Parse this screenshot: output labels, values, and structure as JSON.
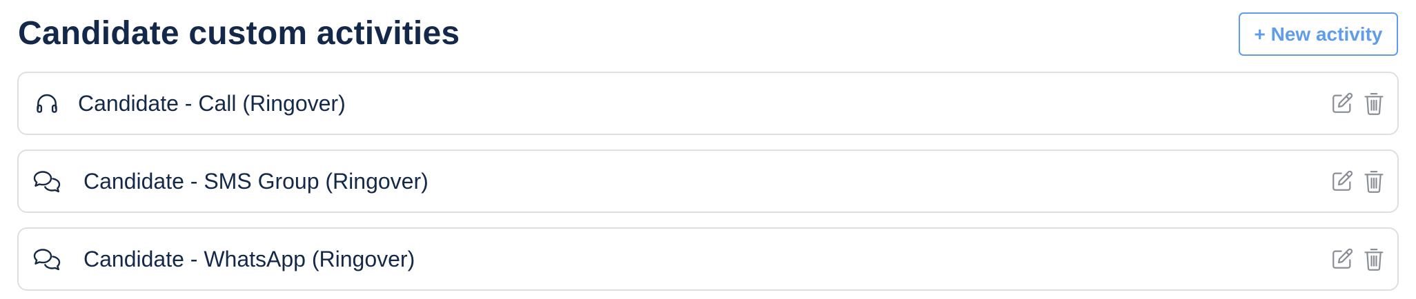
{
  "header": {
    "title": "Candidate custom activities",
    "new_activity_label": "+ New activity"
  },
  "activities": [
    {
      "label": "Candidate - Call (Ringover)",
      "icon": "headphones-icon"
    },
    {
      "label": "Candidate - SMS Group (Ringover)",
      "icon": "chat-bubbles-icon"
    },
    {
      "label": "Candidate - WhatsApp (Ringover)",
      "icon": "chat-bubbles-icon"
    }
  ],
  "colors": {
    "title": "#14294a",
    "accent": "#5f9cec",
    "border": "#dcdfe4",
    "action_icon": "#8a8f96"
  }
}
